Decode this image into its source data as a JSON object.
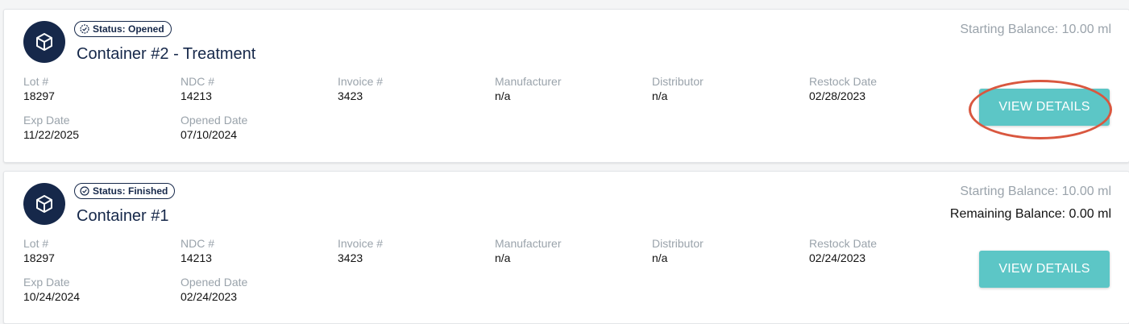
{
  "colors": {
    "navy": "#16284a",
    "teal_button": "#5cc6c6",
    "muted_text": "#9aa3ab",
    "annotation_red": "#d9573f"
  },
  "containers": [
    {
      "status_icon": "clock-check-icon",
      "status": "Status: Opened",
      "title": "Container #2 - Treatment",
      "starting_balance": "Starting Balance: 10.00 ml",
      "remaining_balance": "",
      "lot_label": "Lot #",
      "lot": "18297",
      "ndc_label": "NDC #",
      "ndc": "14213",
      "invoice_label": "Invoice #",
      "invoice": "3423",
      "manufacturer_label": "Manufacturer",
      "manufacturer": "n/a",
      "distributor_label": "Distributor",
      "distributor": "n/a",
      "restock_label": "Restock Date",
      "restock": "02/28/2023",
      "exp_label": "Exp Date",
      "exp": "11/22/2025",
      "opened_label": "Opened Date",
      "opened": "07/10/2024",
      "button": "VIEW DETAILS",
      "button_highlighted": true
    },
    {
      "status_icon": "check-circle-icon",
      "status": "Status: Finished",
      "title": "Container #1",
      "starting_balance": "Starting Balance: 10.00 ml",
      "remaining_balance": "Remaining Balance: 0.00 ml",
      "lot_label": "Lot #",
      "lot": "18297",
      "ndc_label": "NDC #",
      "ndc": "14213",
      "invoice_label": "Invoice #",
      "invoice": "3423",
      "manufacturer_label": "Manufacturer",
      "manufacturer": "n/a",
      "distributor_label": "Distributor",
      "distributor": "n/a",
      "restock_label": "Restock Date",
      "restock": "02/24/2023",
      "exp_label": "Exp Date",
      "exp": "10/24/2024",
      "opened_label": "Opened Date",
      "opened": "02/24/2023",
      "button": "VIEW DETAILS",
      "button_highlighted": false
    }
  ]
}
